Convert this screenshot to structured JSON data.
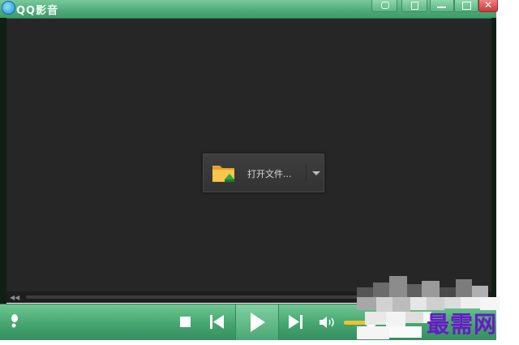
{
  "window": {
    "title": "QQ影音"
  },
  "center_panel": {
    "open_file_label": "打开文件...",
    "folder_icon": "folder-icon",
    "dropdown_icon": "chevron-down-icon"
  },
  "progress": {
    "value": 0
  },
  "controls": {
    "stop_icon": "stop-icon",
    "prev_icon": "previous-track-icon",
    "play_icon": "play-icon",
    "next_icon": "next-track-icon",
    "volume_icon": "speaker-icon",
    "volume_level": 0.8
  },
  "watermark": {
    "text": "最需网"
  },
  "colors": {
    "accent": "#4faa78",
    "video_bg": "#262626",
    "watermark": "#6a18c9"
  }
}
